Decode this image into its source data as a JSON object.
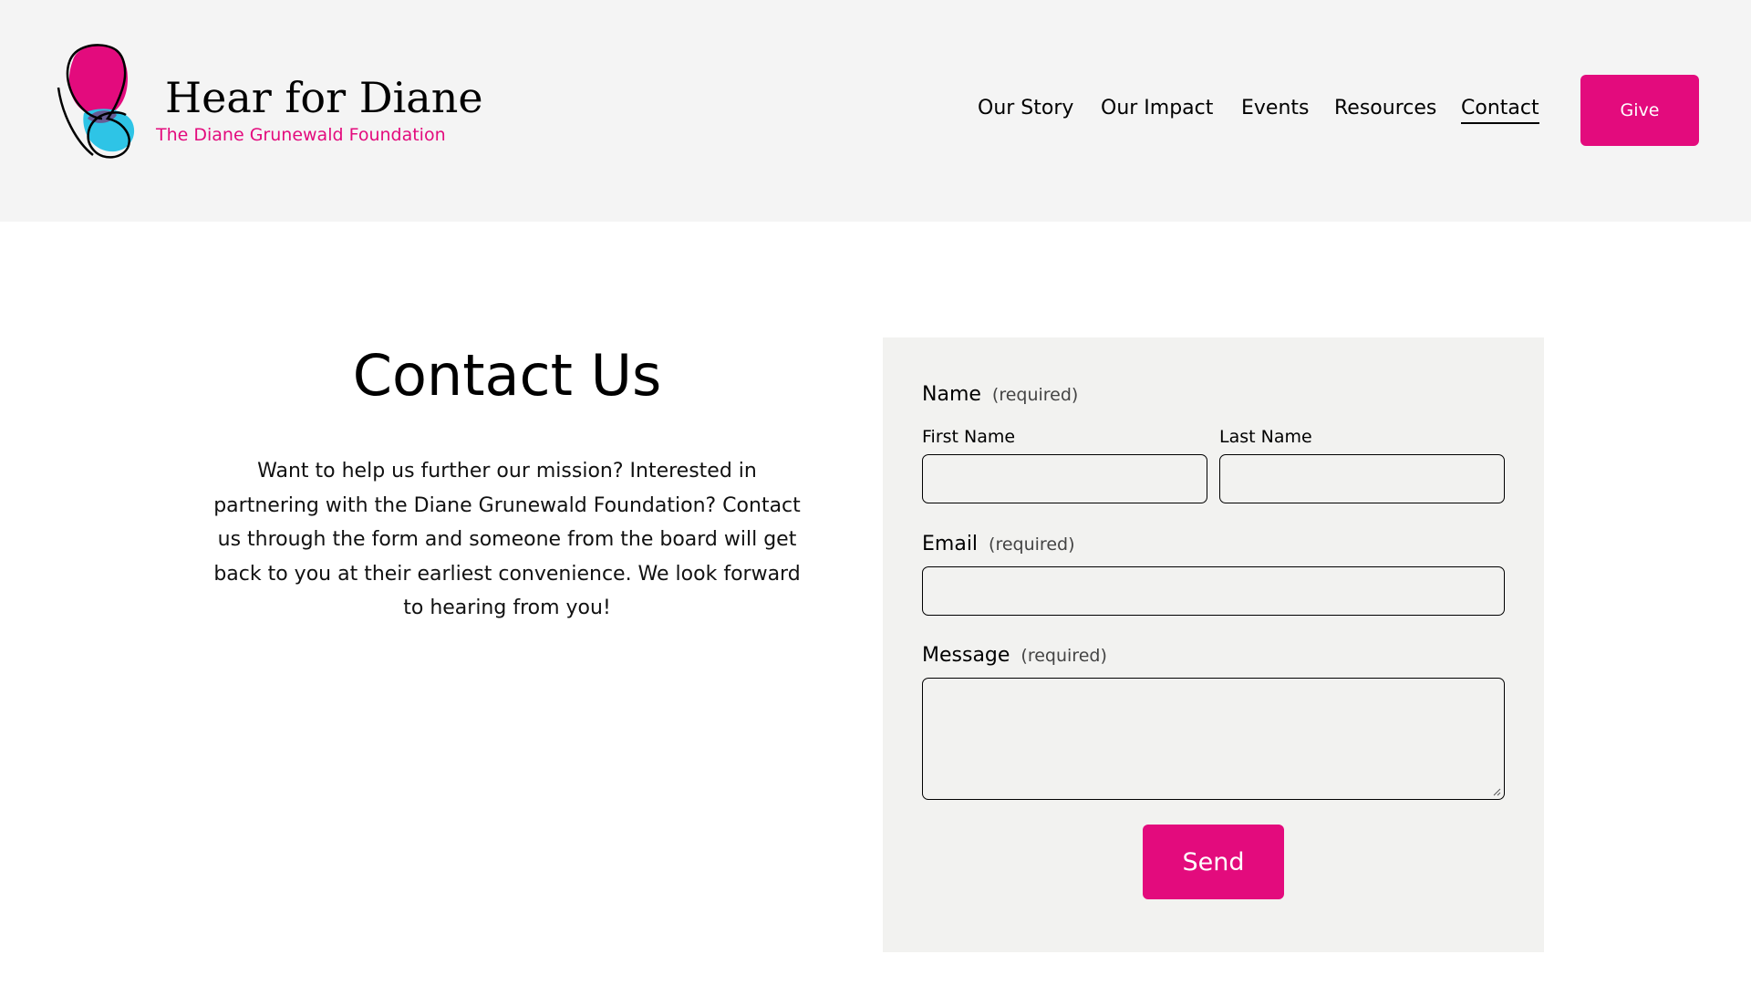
{
  "brand": {
    "title": "Hear for Diane",
    "subtitle": "The Diane Grunewald Foundation",
    "logo_icon": "butterfly-logo-icon"
  },
  "nav": {
    "items": [
      {
        "label": "Our Story",
        "active": false
      },
      {
        "label": "Our Impact",
        "active": false
      },
      {
        "label": "Events",
        "active": false
      },
      {
        "label": "Resources",
        "active": false
      },
      {
        "label": "Contact",
        "active": true
      }
    ],
    "give_label": "Give"
  },
  "intro": {
    "title": "Contact Us",
    "text": "Want to help us further our mission? Interested in partnering with the Diane Grunewald Foundation? Contact us through the form and someone from the board will get back to you at their earliest convenience. We look forward to hearing from you!"
  },
  "form": {
    "name_label": "Name",
    "name_required": "(required)",
    "first_name_label": "First Name",
    "first_name_value": "",
    "last_name_label": "Last Name",
    "last_name_value": "",
    "email_label": "Email",
    "email_required": "(required)",
    "email_value": "",
    "message_label": "Message",
    "message_required": "(required)",
    "message_value": "",
    "send_label": "Send"
  },
  "colors": {
    "accent": "#e30b7d",
    "accent_blue": "#2ec4e6",
    "header_bg": "#f4f4f4",
    "form_bg": "#f2f2f0"
  }
}
